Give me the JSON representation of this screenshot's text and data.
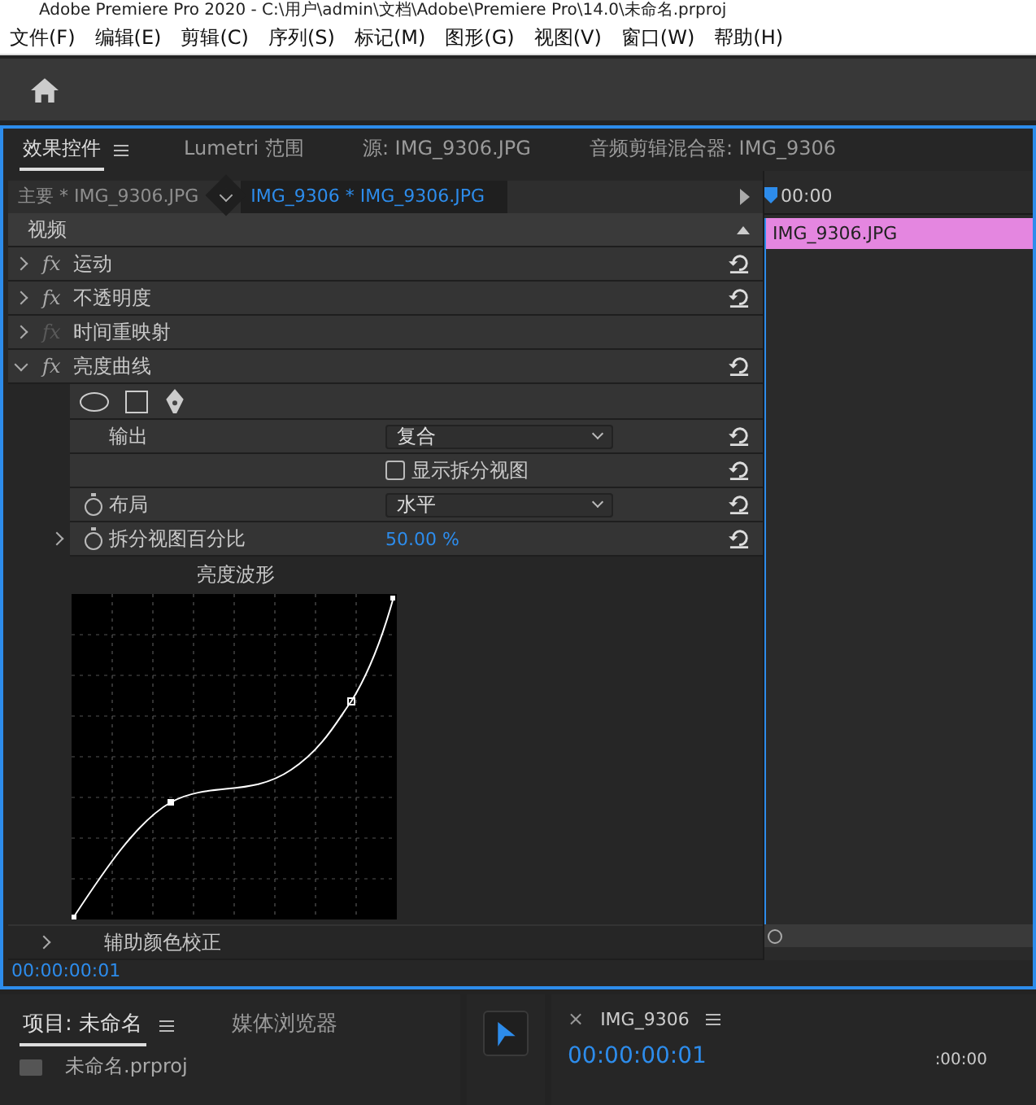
{
  "window": {
    "title": "Adobe Premiere Pro 2020 - C:\\用户\\admin\\文档\\Adobe\\Premiere Pro\\14.0\\未命名.prproj"
  },
  "menu": [
    "文件(F)",
    "编辑(E)",
    "剪辑(C)",
    "序列(S)",
    "标记(M)",
    "图形(G)",
    "视图(V)",
    "窗口(W)",
    "帮助(H)"
  ],
  "effect_panel": {
    "tabs": [
      {
        "label": "效果控件",
        "selected": true,
        "menu": true
      },
      {
        "label": "Lumetri 范围",
        "selected": false
      },
      {
        "label": "源: IMG_9306.JPG",
        "selected": false
      },
      {
        "label": "音频剪辑混合器: IMG_9306",
        "selected": false
      }
    ],
    "clip_tabs": [
      {
        "label": "主要 * IMG_9306.JPG",
        "selected": false
      },
      {
        "label": "IMG_9306 * IMG_9306.JPG",
        "selected": true
      }
    ],
    "section": "视频",
    "effects": [
      {
        "fx": "fx",
        "name": "运动",
        "expanded": false,
        "fx_enabled": true,
        "resettable": true
      },
      {
        "fx": "fx",
        "name": "不透明度",
        "expanded": false,
        "fx_enabled": true,
        "resettable": true
      },
      {
        "fx": "fx",
        "name": "时间重映射",
        "expanded": false,
        "fx_enabled": false
      },
      {
        "fx": "fx",
        "name": "亮度曲线",
        "expanded": true,
        "fx_enabled": true,
        "resettable": true
      }
    ],
    "properties": [
      {
        "kind": "dropdown",
        "label": "输出",
        "value": "复合"
      },
      {
        "kind": "checkbox",
        "label": "显示拆分视图",
        "checked": false
      },
      {
        "kind": "dropdown",
        "label": "布局",
        "value": "水平",
        "stopwatch": true
      },
      {
        "kind": "value",
        "label": "拆分视图百分比",
        "value": "50.00 %",
        "stopwatch": true,
        "expandable": true
      }
    ],
    "graph_label": "亮度波形",
    "secondary": {
      "label": "辅助颜色校正",
      "expanded": false
    },
    "timecode": "00:00:00:01"
  },
  "timeline": {
    "ruler_label": "00:00",
    "clip": "IMG_9306.JPG"
  },
  "project_panel": {
    "tabs": [
      {
        "label": "项目: 未命名",
        "selected": true,
        "menu": true
      },
      {
        "label": "媒体浏览器",
        "selected": false
      }
    ],
    "items": [
      {
        "name": "未命名.prproj"
      }
    ]
  },
  "program_panel": {
    "close": "×",
    "title": "IMG_9306",
    "timecode": "00:00:00:01",
    "duration": ":00:00"
  }
}
